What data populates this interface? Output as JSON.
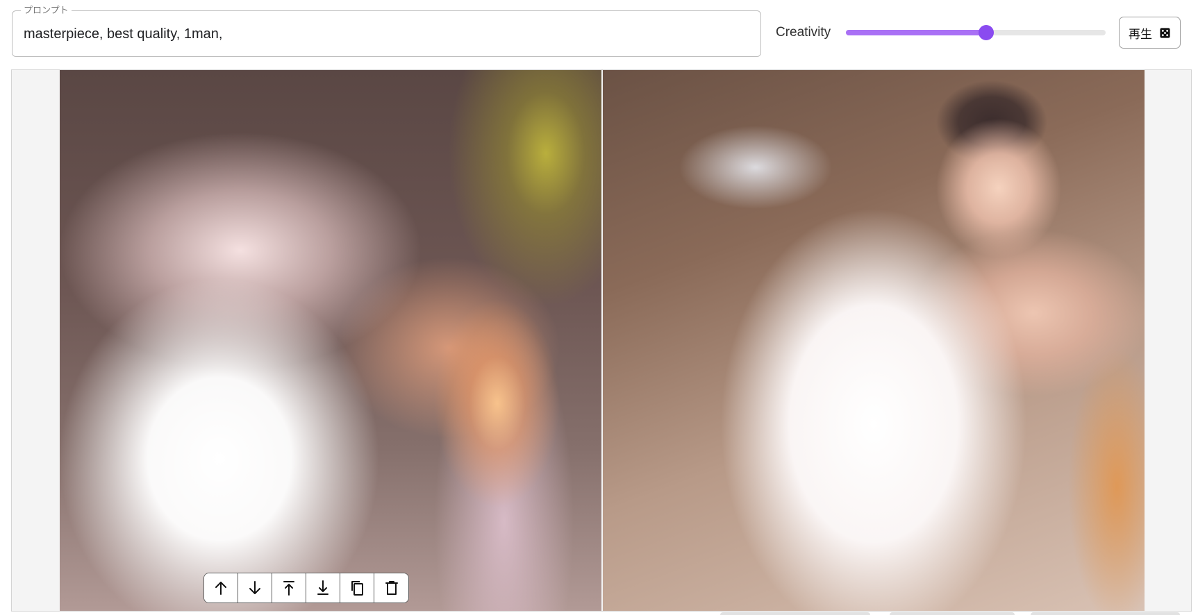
{
  "prompt": {
    "legend": "プロンプト",
    "value": "masterpiece, best quality, 1man,"
  },
  "creativity": {
    "label": "Creativity",
    "value_fraction": 0.54
  },
  "play_button": {
    "label": "再生",
    "icon": "dice-icon"
  },
  "colors": {
    "accent": "#8a4bf0",
    "accent_fill": "#a970f5",
    "border": "#bdbdbd"
  },
  "frames": [
    {
      "name": "input-frame",
      "description_icon": "image"
    },
    {
      "name": "output-frame",
      "description_icon": "image"
    }
  ],
  "frame_toolbar": {
    "buttons": [
      {
        "name": "move-up-button",
        "icon": "arrow-up-icon"
      },
      {
        "name": "move-down-button",
        "icon": "arrow-down-icon"
      },
      {
        "name": "move-to-top-button",
        "icon": "arrow-to-top-icon"
      },
      {
        "name": "move-to-bottom-button",
        "icon": "arrow-to-bottom-icon"
      },
      {
        "name": "duplicate-button",
        "icon": "copy-icon"
      },
      {
        "name": "delete-button",
        "icon": "trash-icon"
      }
    ]
  }
}
